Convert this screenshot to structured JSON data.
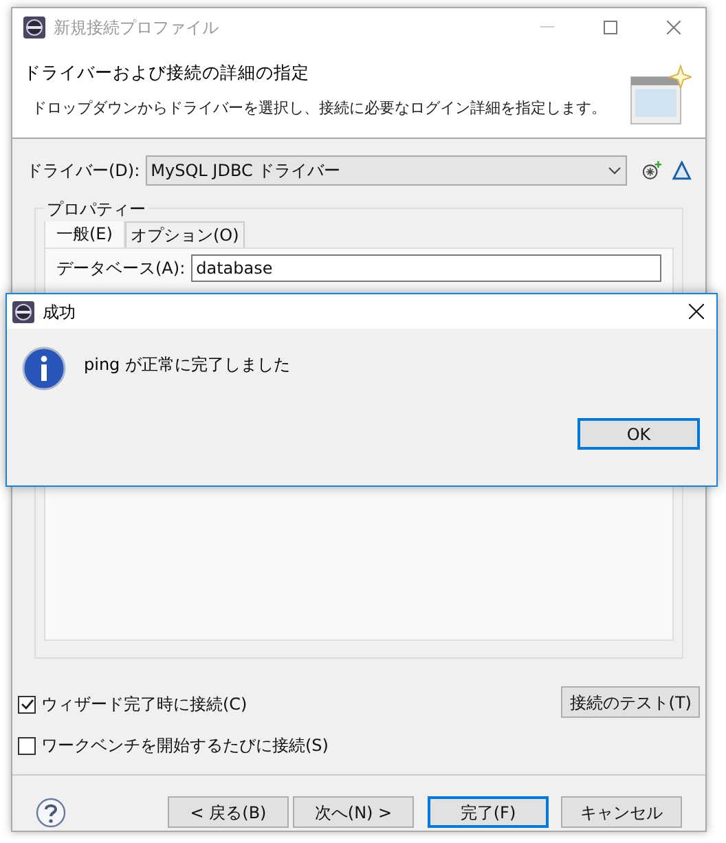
{
  "window": {
    "title": "新規接続プロファイル"
  },
  "header": {
    "title": "ドライバーおよび接続の詳細の指定",
    "description": "ドロップダウンからドライバーを選択し、接続に必要なログイン詳細を指定します。"
  },
  "driver": {
    "label": "ドライバー(D):",
    "value": "MySQL JDBC ドライバー"
  },
  "properties": {
    "title": "プロパティー",
    "tabs": [
      {
        "label": "一般(E)",
        "selected": true
      },
      {
        "label": "オプション(O)",
        "selected": false
      }
    ],
    "fields": [
      {
        "label": "データベース(A):",
        "value": "database"
      }
    ]
  },
  "checkboxes": [
    {
      "label": "ウィザード完了時に接続(C)",
      "checked": true
    },
    {
      "label": "ワークベンチを開始するたびに接続(S)",
      "checked": false
    }
  ],
  "test_button": "接続のテスト(T)",
  "buttons": [
    {
      "label": "< 戻る(B)",
      "default": false
    },
    {
      "label": "次へ(N) >",
      "default": false
    },
    {
      "label": "完了(F)",
      "default": true
    },
    {
      "label": "キャンセル",
      "default": false
    }
  ],
  "dialog": {
    "title": "成功",
    "message": "ping が正常に完了しました",
    "button": "OK"
  }
}
